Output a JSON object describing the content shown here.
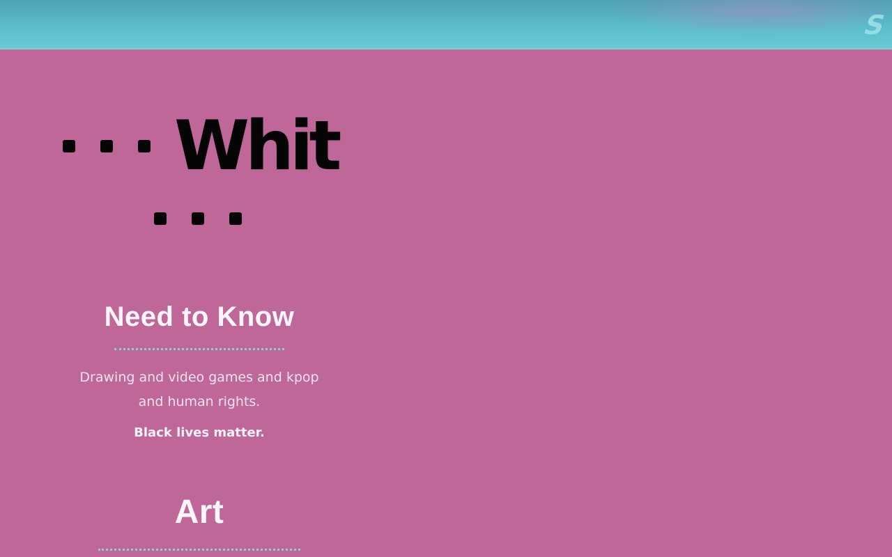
{
  "header": {
    "corner_glyph": "S"
  },
  "site": {
    "title": "Whit"
  },
  "sections": {
    "need_to_know": {
      "heading": "Need to Know",
      "description": "Drawing and video games and kpop and human rights.",
      "emphasis": "Black lives matter."
    },
    "art": {
      "heading": "Art"
    }
  },
  "colors": {
    "background": "#be6798",
    "header": "#5cbccb",
    "accent_rule": "#7cd6e6",
    "title_text": "#050505"
  }
}
